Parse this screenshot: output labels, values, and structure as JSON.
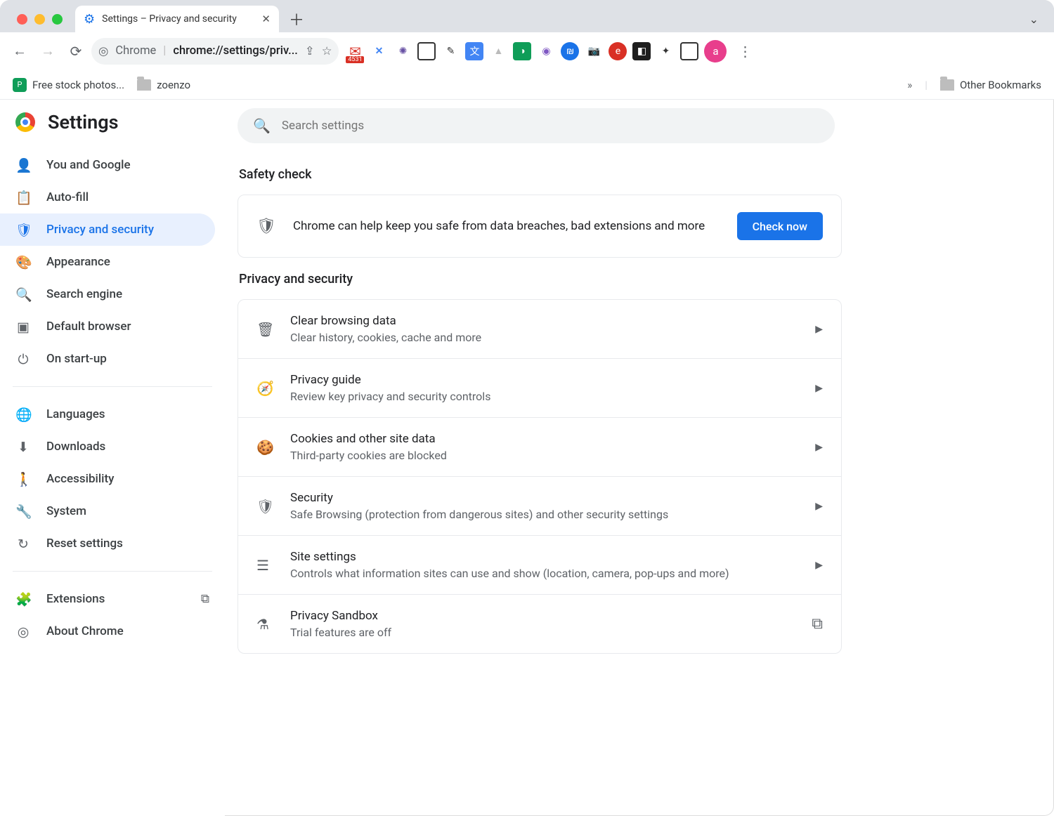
{
  "tab": {
    "title": "Settings – Privacy and security"
  },
  "omnibox": {
    "scheme": "Chrome",
    "url": "chrome://settings/priv..."
  },
  "bookmarks": {
    "items": [
      {
        "label": "Free stock photos..."
      },
      {
        "label": "zoenzo"
      }
    ],
    "overflow": "»",
    "other": "Other Bookmarks"
  },
  "gmail_badge": "4531",
  "avatar_letter": "a",
  "settings": {
    "title": "Settings",
    "search_placeholder": "Search settings",
    "nav": {
      "section1": [
        {
          "icon": "person",
          "label": "You and Google"
        },
        {
          "icon": "clipboard",
          "label": "Auto-fill"
        },
        {
          "icon": "shield",
          "label": "Privacy and security",
          "active": true
        },
        {
          "icon": "palette",
          "label": "Appearance"
        },
        {
          "icon": "search",
          "label": "Search engine"
        },
        {
          "icon": "window",
          "label": "Default browser"
        },
        {
          "icon": "power",
          "label": "On start-up"
        }
      ],
      "section2": [
        {
          "icon": "globe",
          "label": "Languages"
        },
        {
          "icon": "download",
          "label": "Downloads"
        },
        {
          "icon": "accessibility",
          "label": "Accessibility"
        },
        {
          "icon": "wrench",
          "label": "System"
        },
        {
          "icon": "reset",
          "label": "Reset settings"
        }
      ],
      "section3": [
        {
          "icon": "extension",
          "label": "Extensions",
          "external": true
        },
        {
          "icon": "chrome",
          "label": "About Chrome"
        }
      ]
    },
    "safety": {
      "heading": "Safety check",
      "text": "Chrome can help keep you safe from data breaches, bad extensions and more",
      "button": "Check now"
    },
    "privacy": {
      "heading": "Privacy and security",
      "rows": [
        {
          "icon": "trash",
          "title": "Clear browsing data",
          "sub": "Clear history, cookies, cache and more"
        },
        {
          "icon": "compass",
          "title": "Privacy guide",
          "sub": "Review key privacy and security controls"
        },
        {
          "icon": "cookie",
          "title": "Cookies and other site data",
          "sub": "Third-party cookies are blocked"
        },
        {
          "icon": "shield",
          "title": "Security",
          "sub": "Safe Browsing (protection from dangerous sites) and other security settings"
        },
        {
          "icon": "tune",
          "title": "Site settings",
          "sub": "Controls what information sites can use and show (location, camera, pop-ups and more)"
        },
        {
          "icon": "flask",
          "title": "Privacy Sandbox",
          "sub": "Trial features are off",
          "link": true
        }
      ]
    }
  }
}
